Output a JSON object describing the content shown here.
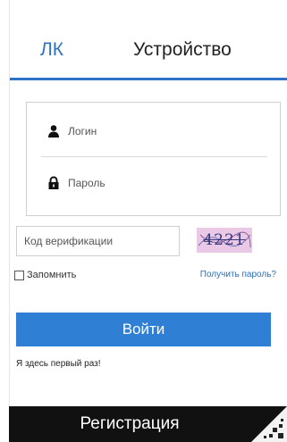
{
  "tabs": [
    {
      "label": "ЛК",
      "active": true
    },
    {
      "label": "Устройство",
      "active": false
    }
  ],
  "login": {
    "username_placeholder": "Логин",
    "password_placeholder": "Пароль"
  },
  "captcha": {
    "placeholder": "Код верификации",
    "code": "4221"
  },
  "remember": {
    "label": "Запомнить"
  },
  "get_password": {
    "label": "Получить пароль?"
  },
  "submit": {
    "label": "Войти"
  },
  "first_time": {
    "label": "Я здесь первый раз!"
  },
  "register": {
    "label": "Регистрация"
  },
  "icons": {
    "user": "user-icon",
    "lock": "lock-icon",
    "checkbox": "checkbox-icon",
    "qr_corner": "qr-code-icon"
  },
  "colors": {
    "accent": "#2f73c9",
    "button": "#2f7fd4",
    "register_bar": "#111111",
    "captcha_bg": "#e9c9e6"
  }
}
